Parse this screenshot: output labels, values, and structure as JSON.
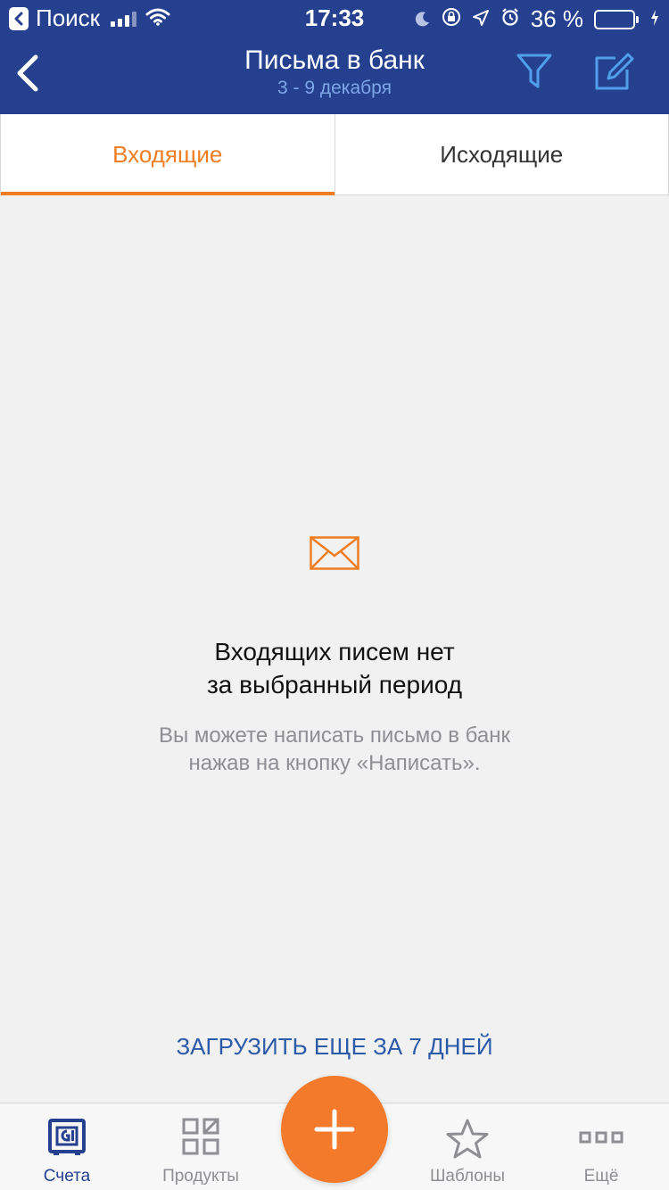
{
  "status_bar": {
    "back_app": "Поиск",
    "time": "17:33",
    "battery_percent": "36 %",
    "battery_level": 0.36
  },
  "header": {
    "title": "Письма в банк",
    "subtitle": "3 - 9 декабря",
    "icons": [
      "chevron-left-icon",
      "filter-icon",
      "compose-icon"
    ]
  },
  "tabs": [
    {
      "label": "Входящие",
      "active": true
    },
    {
      "label": "Исходящие",
      "active": false
    }
  ],
  "empty_state": {
    "icon": "envelope-icon",
    "title_line1": "Входящих писем нет",
    "title_line2": "за выбранный период",
    "hint_line1": "Вы можете написать письмо в банк",
    "hint_line2": "нажав на кнопку «Написать»."
  },
  "load_more": "ЗАГРУЗИТЬ ЕЩЕ ЗА 7 ДНЕЙ",
  "tabbar": {
    "items": [
      {
        "label": "Счета",
        "icon": "safe-icon",
        "active": true
      },
      {
        "label": "Продукты",
        "icon": "grid-icon",
        "active": false
      },
      {
        "label": "Шаблоны",
        "icon": "star-icon",
        "active": false
      },
      {
        "label": "Ещё",
        "icon": "more-icon",
        "active": false
      }
    ],
    "fab_icon": "plus-icon"
  },
  "colors": {
    "header_bg": "#24408f",
    "accent": "#f07d22",
    "link": "#2a5aa8",
    "background": "#f1f1f2"
  }
}
